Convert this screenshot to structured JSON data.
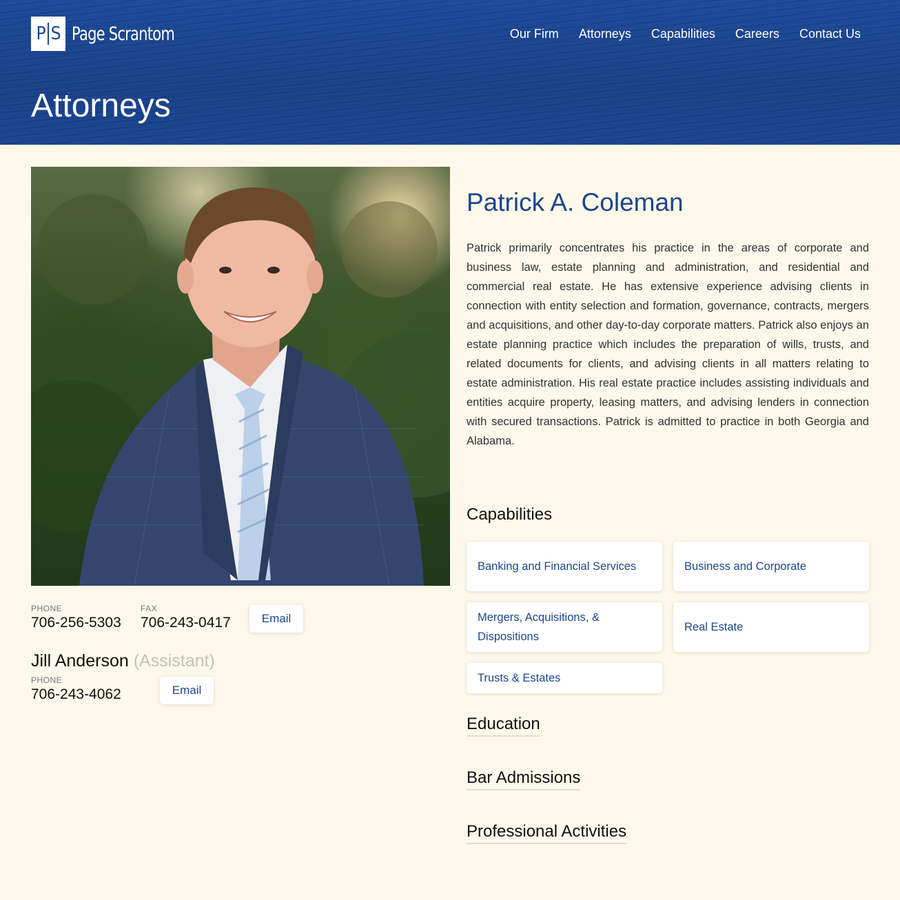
{
  "site": {
    "logo_mark": "P|S",
    "logo_text": "Page Scrantom",
    "nav": [
      "Our Firm",
      "Attorneys",
      "Capabilities",
      "Careers",
      "Contact Us"
    ],
    "page_heading": "Attorneys"
  },
  "attorney": {
    "name": "Patrick A. Coleman",
    "bio": "Patrick primarily concentrates his practice in the areas of corporate and business law, estate planning and administration, and residential and commercial real estate. He has extensive experience advising clients in connection with entity selection and formation, governance, contracts, mergers and acquisitions, and other day-to-day corporate matters. Patrick also enjoys an estate planning practice which includes the preparation of wills, trusts, and related documents for clients, and advising clients in all matters relating to estate administration. His real estate practice includes assisting individuals and entities acquire property, leasing matters, and advising lenders in connection with secured transactions. Patrick is admitted to practice in both Georgia and Alabama.",
    "phone_label": "PHONE",
    "phone": "706-256-5303",
    "fax_label": "FAX",
    "fax": "706-243-0417",
    "email_label": "Email"
  },
  "assistant": {
    "name": "Jill Anderson",
    "role": "(Assistant)",
    "phone_label": "PHONE",
    "phone": "706-243-4062",
    "email_label": "Email"
  },
  "sections": {
    "capabilities_title": "Capabilities",
    "capabilities": [
      "Banking and Financial Services",
      "Business and Corporate",
      "Mergers, Acquisitions, & Dispositions",
      "Real Estate",
      "Trusts & Estates"
    ],
    "education_title": "Education",
    "bar_title": "Bar Admissions",
    "activities_title": "Professional Activities"
  },
  "colors": {
    "brand_blue": "#1c4590",
    "background": "#fdf8ea"
  }
}
